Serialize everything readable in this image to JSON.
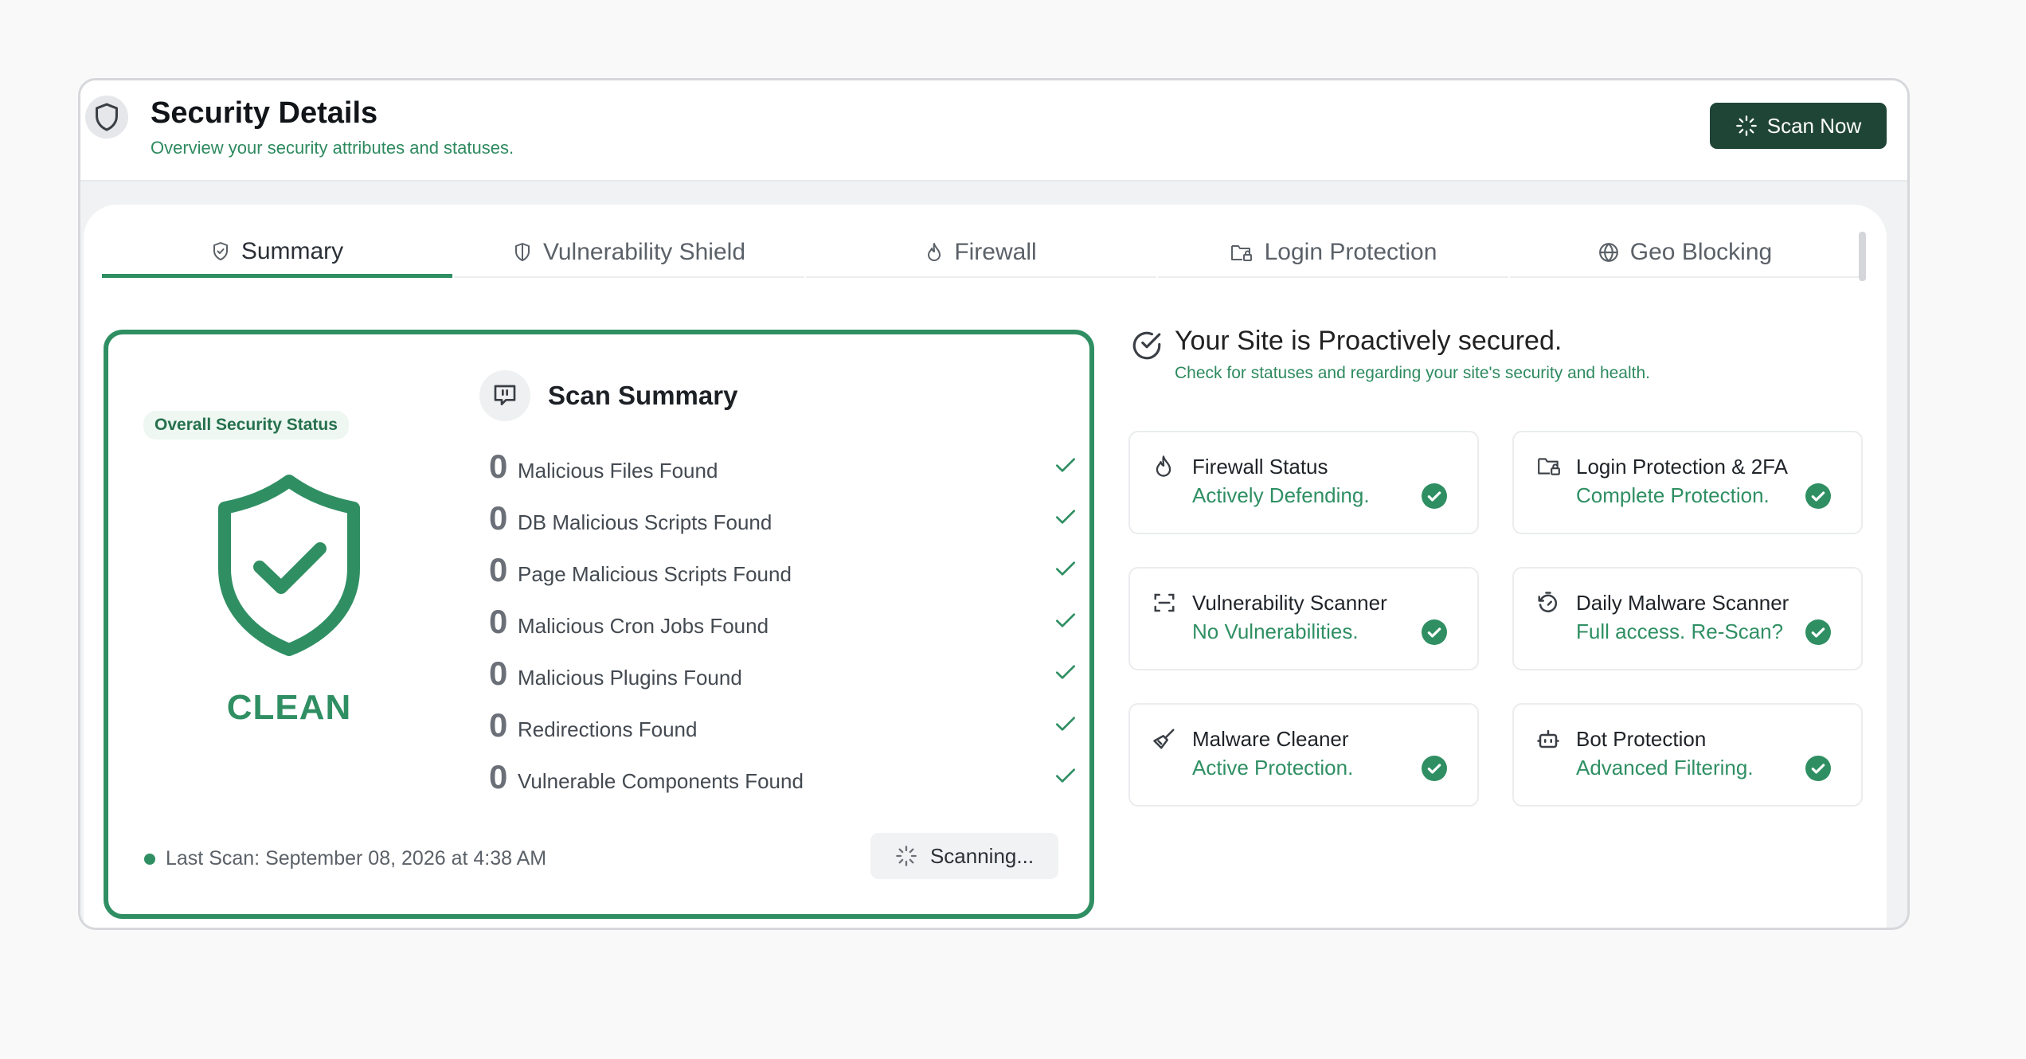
{
  "header": {
    "title": "Security Details",
    "subtitle": "Overview your security attributes and statuses.",
    "scan_now_label": "Scan Now"
  },
  "tabs": [
    {
      "label": "Summary",
      "icon": "shield-check-icon",
      "active": true
    },
    {
      "label": "Vulnerability Shield",
      "icon": "half-shield-icon",
      "active": false
    },
    {
      "label": "Firewall",
      "icon": "flame-icon",
      "active": false
    },
    {
      "label": "Login Protection",
      "icon": "folder-lock-icon",
      "active": false
    },
    {
      "label": "Geo Blocking",
      "icon": "globe-icon",
      "active": false
    }
  ],
  "scan_summary": {
    "status_pill": "Overall Security Status",
    "status_label": "CLEAN",
    "title": "Scan Summary",
    "results": [
      {
        "count": "0",
        "label": "Malicious Files Found"
      },
      {
        "count": "0",
        "label": "DB Malicious Scripts Found"
      },
      {
        "count": "0",
        "label": "Page Malicious Scripts Found"
      },
      {
        "count": "0",
        "label": "Malicious Cron Jobs Found"
      },
      {
        "count": "0",
        "label": "Malicious Plugins Found"
      },
      {
        "count": "0",
        "label": "Redirections Found"
      },
      {
        "count": "0",
        "label": "Vulnerable Components Found"
      }
    ],
    "last_scan": "Last Scan: September 08, 2026 at 4:38 AM",
    "scanning_label": "Scanning..."
  },
  "overview": {
    "title": "Your Site is Proactively secured.",
    "subtitle": "Check for statuses and regarding your site's security and health."
  },
  "features": [
    {
      "title": "Firewall Status",
      "status": "Actively Defending.",
      "icon": "flame-icon"
    },
    {
      "title": "Login Protection & 2FA",
      "status": "Complete Protection.",
      "icon": "folder-lock-icon"
    },
    {
      "title": "Vulnerability Scanner",
      "status": "No Vulnerabilities.",
      "icon": "scan-frame-icon"
    },
    {
      "title": "Daily Malware Scanner",
      "status": "Full access. Re-Scan?",
      "icon": "timer-reset-icon"
    },
    {
      "title": "Malware Cleaner",
      "status": "Active Protection.",
      "icon": "broom-icon"
    },
    {
      "title": "Bot Protection",
      "status": "Advanced Filtering.",
      "icon": "bot-icon"
    }
  ],
  "colors": {
    "accent": "#2f8f63",
    "button_dark": "#1f4536"
  }
}
